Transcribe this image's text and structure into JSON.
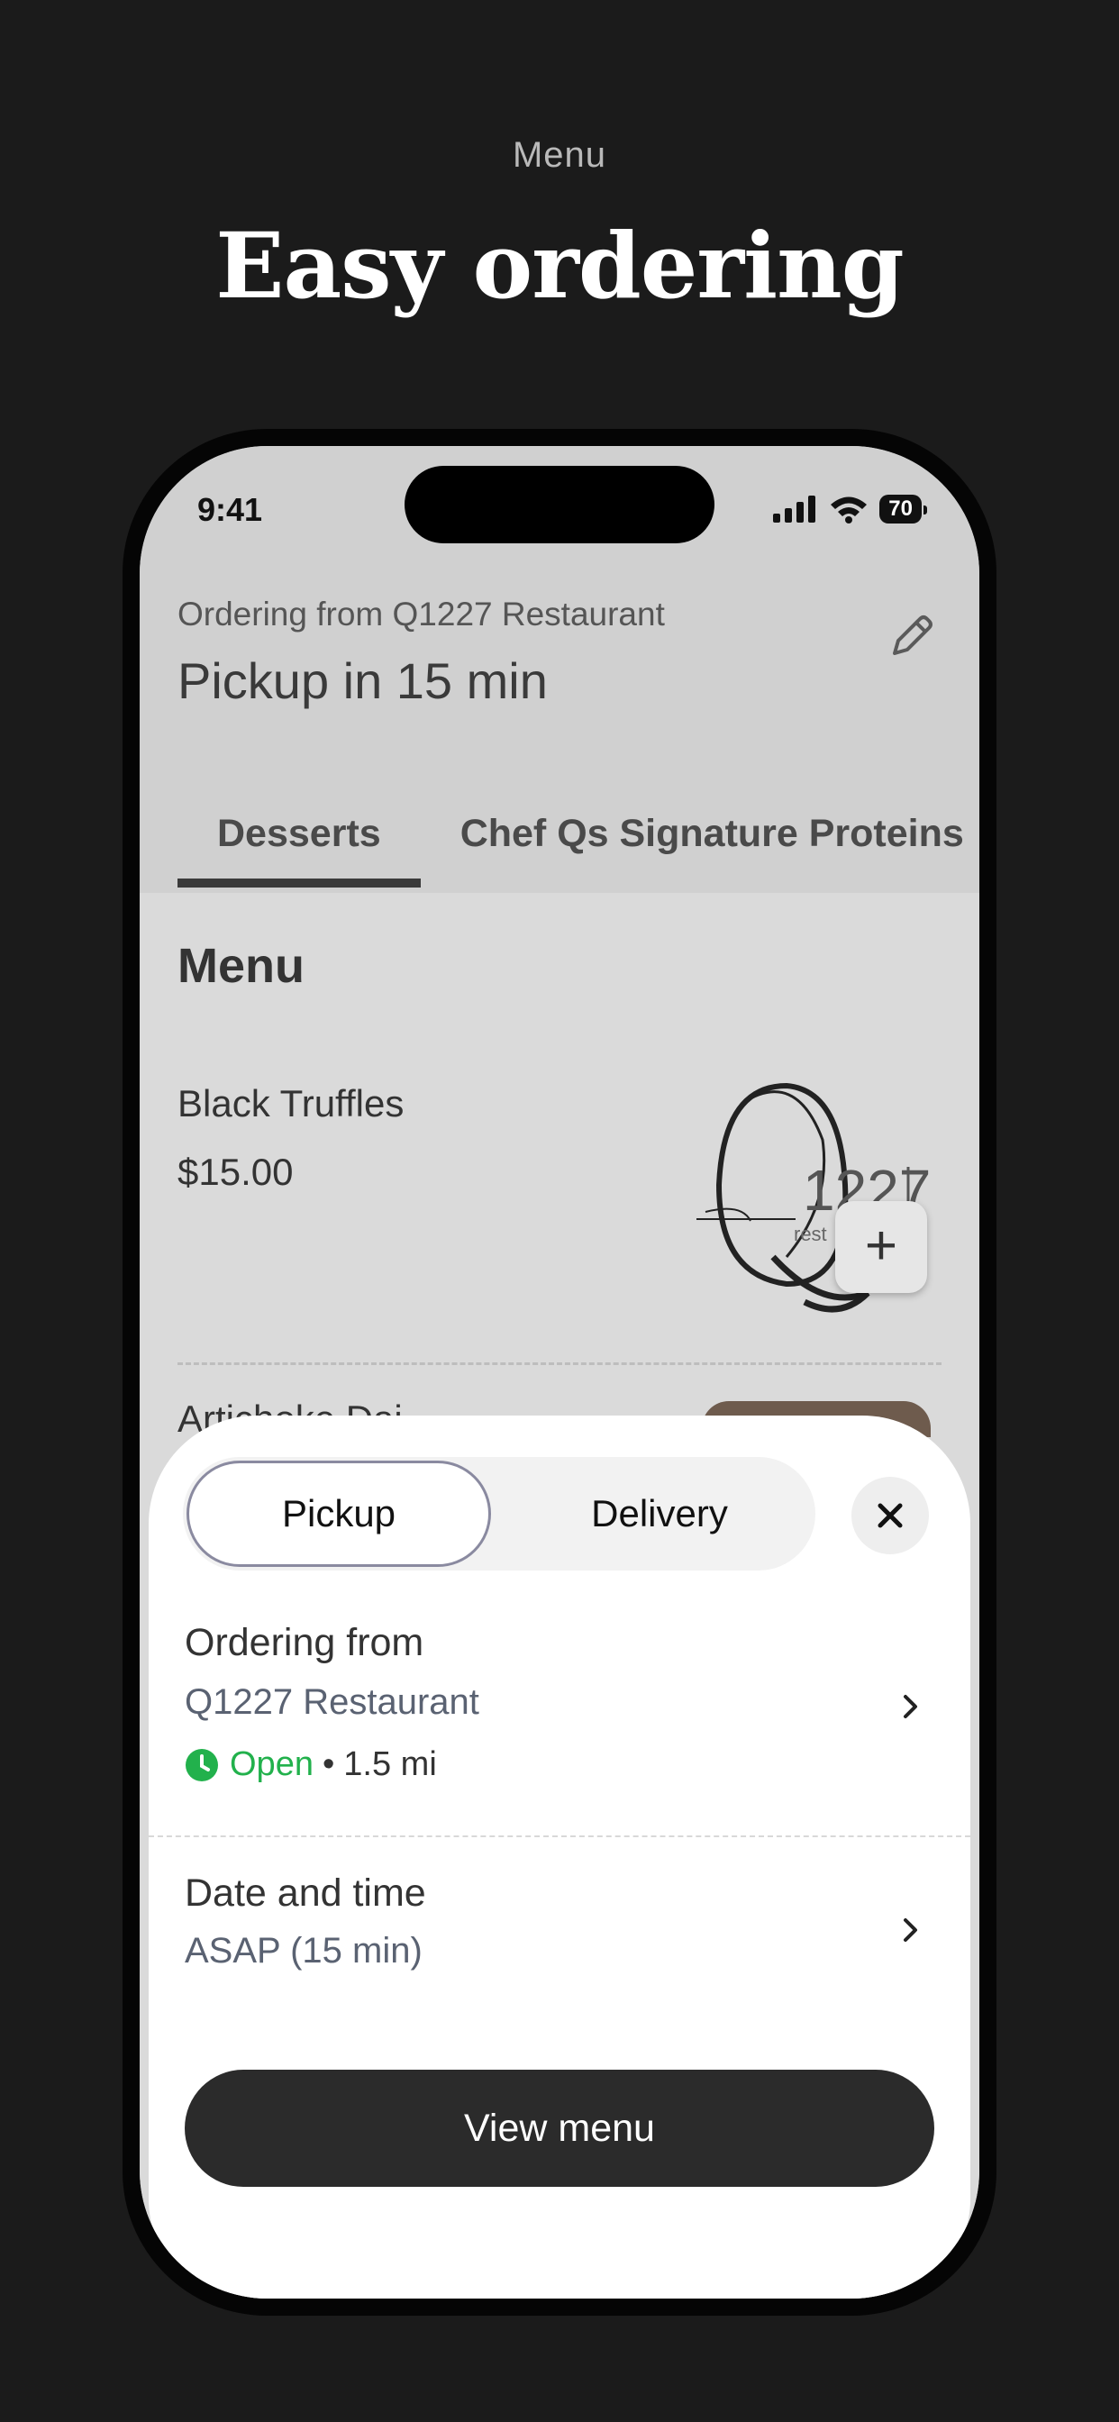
{
  "header": {
    "caption": "Menu",
    "title": "Easy ordering"
  },
  "status_bar": {
    "time": "9:41",
    "battery": "70"
  },
  "order_header": {
    "ordering_from": "Ordering from Q1227 Restaurant",
    "pickup_time": "Pickup in 15 min"
  },
  "tabs": [
    {
      "label": "Desserts",
      "active": true
    },
    {
      "label": "Chef Qs Signature Proteins",
      "active": false
    }
  ],
  "menu": {
    "title": "Menu",
    "items": [
      {
        "name": "Black Truffles",
        "price": "$15.00"
      },
      {
        "name": "Artichoke Dai",
        "price": ""
      }
    ],
    "add_label": "+"
  },
  "sheet": {
    "mode_options": [
      "Pickup",
      "Delivery"
    ],
    "selected_mode": "Pickup",
    "ordering_from_title": "Ordering from",
    "restaurant": "Q1227 Restaurant",
    "open_status": "Open",
    "separator": "•",
    "distance": "1.5 mi",
    "date_time_title": "Date and time",
    "date_time_value": "ASAP (15 min)",
    "cta": "View menu"
  },
  "colors": {
    "open_green": "#22b14c",
    "cta_background": "#2b2b2b",
    "page_background": "#1b1b1b"
  }
}
